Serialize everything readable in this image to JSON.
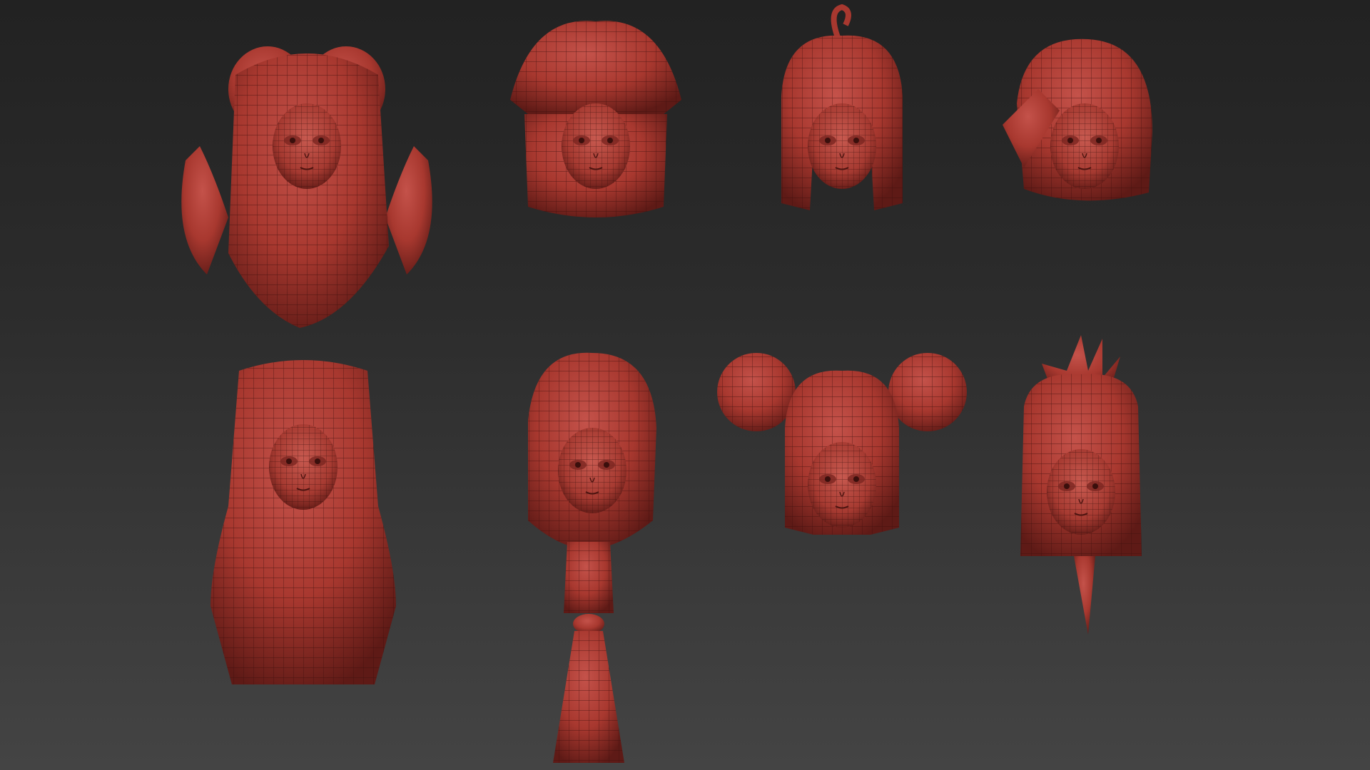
{
  "scene": {
    "background_top": "#222222",
    "background_bottom": "#444444",
    "clay_color": "#a8382f",
    "clay_dark": "#6e1f1a",
    "wire_color": "#3a0f0c"
  },
  "models": [
    {
      "style": "twin-tails"
    },
    {
      "style": "bob-with-wide-bangs"
    },
    {
      "style": "bob-with-antenna-curl"
    },
    {
      "style": "short-side-swept"
    },
    {
      "style": "long-straight-hime"
    },
    {
      "style": "side-part-long-braid"
    },
    {
      "style": "double-buns"
    },
    {
      "style": "spiky-ponytail"
    }
  ]
}
